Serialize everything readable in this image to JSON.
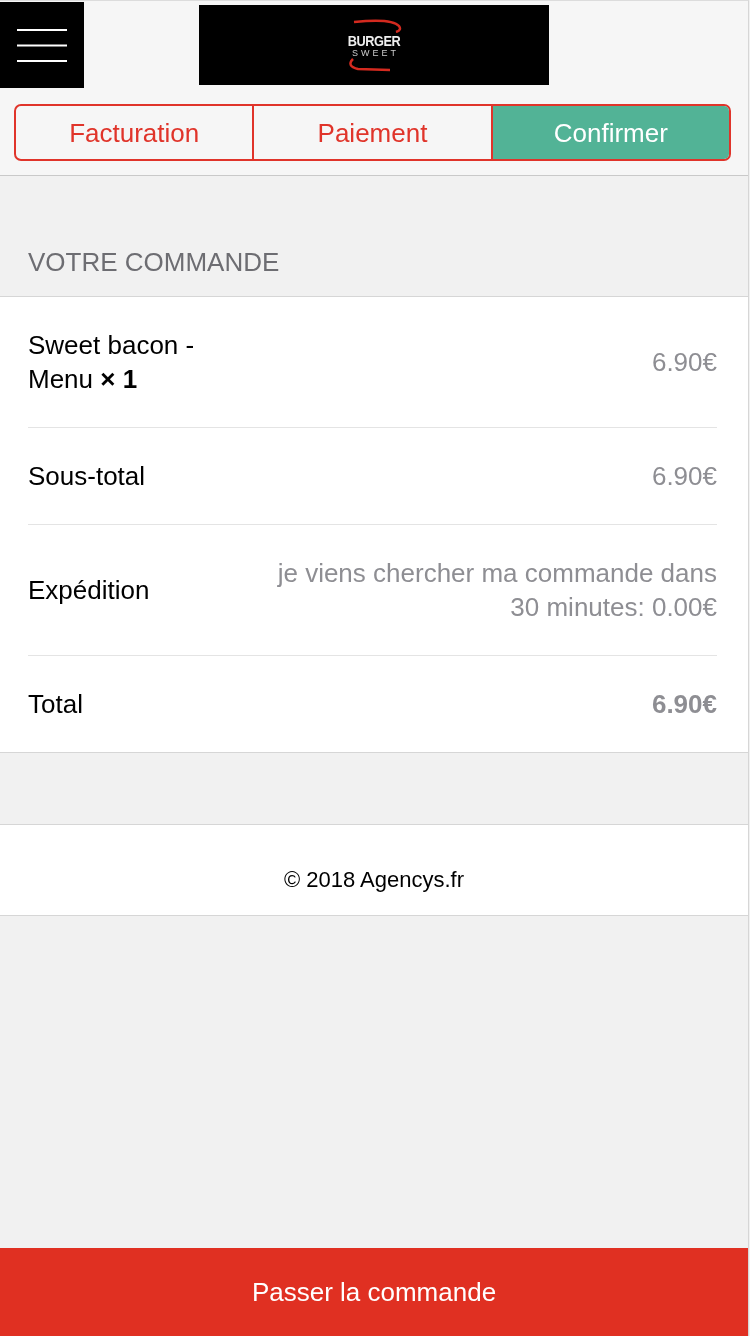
{
  "header": {
    "logo": {
      "title": "BURGER",
      "subtitle": "SWEET"
    }
  },
  "steps": [
    {
      "label": "Facturation",
      "selected": false
    },
    {
      "label": "Paiement",
      "selected": false
    },
    {
      "label": "Confirmer",
      "selected": true
    }
  ],
  "order": {
    "heading": "VOTRE COMMANDE",
    "rows": [
      {
        "kind": "product",
        "label": "Sweet bacon - Menu **× 1**",
        "value": "6.90€"
      },
      {
        "kind": "subtotal",
        "label": "Sous-total",
        "value": "6.90€"
      },
      {
        "kind": "shipping",
        "label": "Expédition",
        "value": "je viens chercher ma commande dans 30 minutes: 0.00€"
      },
      {
        "kind": "total",
        "label": "Total",
        "value": "6.90€"
      }
    ]
  },
  "footer": {
    "copyright": "© 2018 Agencys.fr"
  },
  "place_order_button": {
    "label": "Passer la commande"
  }
}
